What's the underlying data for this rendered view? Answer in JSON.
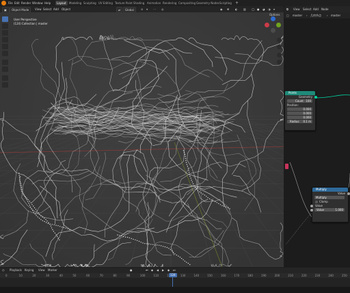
{
  "topbar": {
    "menus": [
      "File",
      "Edit",
      "Render",
      "Window",
      "Help"
    ],
    "workspaces": [
      "Layout",
      "Modeling",
      "Sculpting",
      "UV Editing",
      "Texture Paint",
      "Shading",
      "Animation",
      "Rendering",
      "Compositing",
      "Geometry Nodes",
      "Scripting"
    ],
    "active_workspace": "Layout"
  },
  "viewport": {
    "mode": "Object Mode",
    "menus": [
      "View",
      "Select",
      "Add",
      "Object"
    ],
    "orientation": "Global",
    "info_line1": "User Perspective",
    "info_line2": "(124) Collection | master",
    "options_label": "Options"
  },
  "node_editor": {
    "header_menus": [
      "View",
      "Select",
      "Add",
      "Node"
    ],
    "breadcrumb_object": "master",
    "breadcrumb_tree": "几何节点",
    "breadcrumb_mod": "master",
    "points_node": {
      "title": "Points",
      "output": "Geometry",
      "count_label": "Count",
      "count_value": "100",
      "position_label": "Position:",
      "pos_x": "0.000",
      "pos_y": "0.000",
      "pos_z": "0.000",
      "radius_label": "Radius",
      "radius_value": "0.1 m"
    },
    "multiply_node": {
      "title": "Multiply",
      "output": "Value",
      "operation": "Multiply",
      "clamp": "Clamp",
      "input_label": "Value",
      "value_label": "Value",
      "value": "1.000"
    }
  },
  "timeline": {
    "menus": [
      "Playback",
      "Keying",
      "View",
      "Marker"
    ],
    "ticks": [
      "0",
      "10",
      "20",
      "30",
      "40",
      "50",
      "60",
      "70",
      "80",
      "90",
      "100",
      "110",
      "120",
      "124",
      "130",
      "140",
      "150",
      "160",
      "170",
      "180",
      "190",
      "200",
      "210",
      "220",
      "230",
      "240",
      "250"
    ],
    "current_frame": "124"
  },
  "colors": {
    "accent": "#4772b3",
    "points_header": "#1f8a7a",
    "math_header": "#2e6a9a",
    "geometry_socket": "#00d6a3",
    "value_socket": "#a1a1a1",
    "frame_marker": "#4772b3"
  }
}
